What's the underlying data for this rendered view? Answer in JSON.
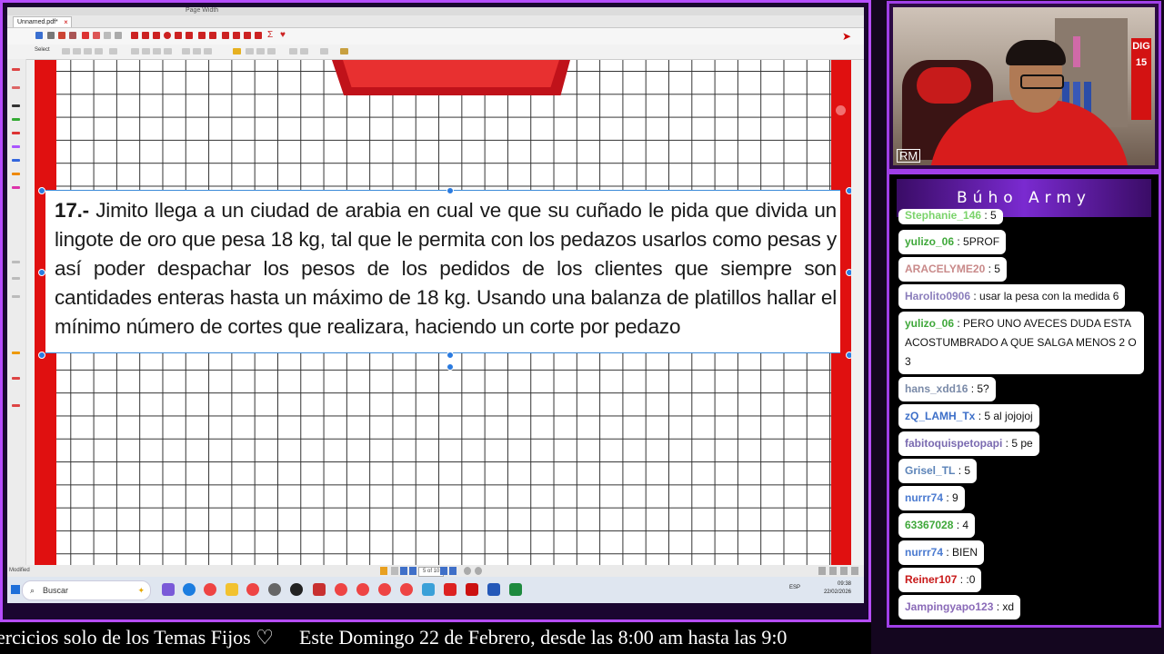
{
  "app": {
    "window_title": "Unnamed.pdf*",
    "zoom_label": "Page Width",
    "select_label": "Select",
    "status_left": "Modified",
    "page_indicator": "5 of 10"
  },
  "problem": {
    "number": "17.-",
    "text": "Jimito llega a un ciudad de arabia en cual ve que su cuñado le pida que divida un lingote de oro que pesa 18 kg, tal que le permita con los pedazos usarlos como pesas y así poder despachar los pesos de los pedidos de los clientes que siempre son cantidades enteras hasta un máximo de 18 kg. Usando una balanza de platillos hallar el mínimo número de cortes que realizara, haciendo un corte por pedazo"
  },
  "taskbar": {
    "search_placeholder": "Buscar",
    "language": "ESP",
    "time": "09:38",
    "date": "22/02/2026"
  },
  "webcam": {
    "sign_text": "DIG\n15",
    "overlay_label": "RM"
  },
  "chat": {
    "title": "Búho Army",
    "messages": [
      {
        "user": "Stephanie_146",
        "text": ": 5",
        "color": "#7bd36b"
      },
      {
        "user": "yulizo_06",
        "text": ": 5PROF",
        "color": "#3fa83a"
      },
      {
        "user": "ARACELYME20",
        "text": ": 5",
        "color": "#c98a8a"
      },
      {
        "user": "Harolito0906",
        "text": ": usar la pesa con la medida 6",
        "color": "#8a7dbb"
      },
      {
        "user": "yulizo_06",
        "text": ": PERO UNO AVECES DUDA ESTA ACOSTUMBRADO A QUE SALGA MENOS 2 O 3",
        "color": "#3fa83a"
      },
      {
        "user": "hans_xdd16",
        "text": ": 5?",
        "color": "#7a8aa8"
      },
      {
        "user": "zQ_LAMH_Tx",
        "text": ": 5 al jojojoj",
        "color": "#3d6fc8"
      },
      {
        "user": "fabitoquispetopapi",
        "text": ": 5 pe",
        "color": "#7a6ab0"
      },
      {
        "user": "Grisel_TL",
        "text": ": 5",
        "color": "#5b83b8"
      },
      {
        "user": "nurrr74",
        "text": ": 9",
        "color": "#4a7ad0"
      },
      {
        "user": "63367028",
        "text": ": 4",
        "color": "#3fa83a"
      },
      {
        "user": "nurrr74",
        "text": ": BIEN",
        "color": "#4a7ad0"
      },
      {
        "user": "Reiner107",
        "text": ": :0",
        "color": "#c81818"
      },
      {
        "user": "Jampingyapo123",
        "text": ": xd",
        "color": "#8a6ab8"
      }
    ]
  },
  "ticker": {
    "segment_1": "ercicios solo de los Temas Fijos ♡",
    "segment_2": "Este Domingo 22 de Febrero, desde las 8:00 am hasta las 9:0"
  },
  "colors": {
    "frame": "#b64dff",
    "accent_red": "#e01010",
    "selection_blue": "#2a7be0"
  }
}
